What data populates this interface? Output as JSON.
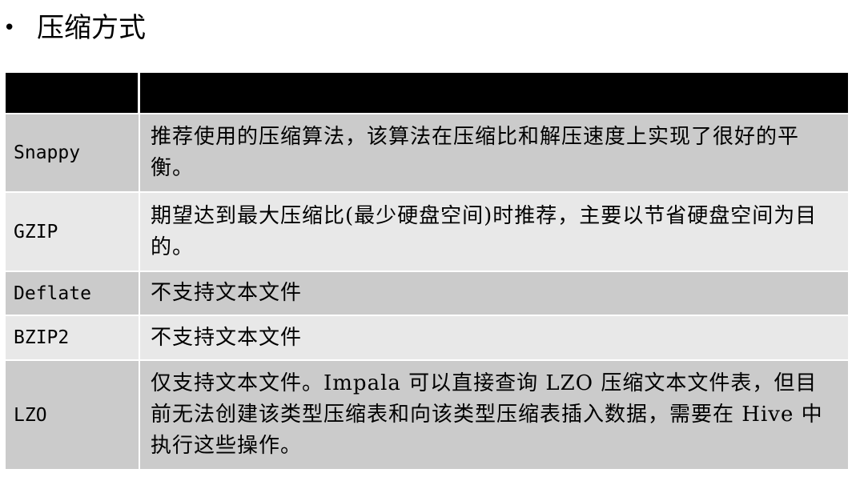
{
  "heading": {
    "bullet": "•",
    "title": "压缩方式"
  },
  "table": {
    "header": {
      "name": "",
      "description": ""
    },
    "rows": [
      {
        "name": "Snappy",
        "description": "推荐使用的压缩算法，该算法在压缩比和解压速度上实现了很好的平衡。",
        "shade": "dark"
      },
      {
        "name": "GZIP",
        "description": "期望达到最大压缩比(最少硬盘空间)时推荐，主要以节省硬盘空间为目的。",
        "shade": "light"
      },
      {
        "name": "Deflate",
        "description": "不支持文本文件",
        "shade": "dark"
      },
      {
        "name": "BZIP2",
        "description": "不支持文本文件",
        "shade": "light"
      },
      {
        "name": "LZO",
        "description": "仅支持文本文件。Impala 可以直接查询 LZO 压缩文本文件表，但目前无法创建该类型压缩表和向该类型压缩表插入数据，需要在 Hive 中执行这些操作。",
        "shade": "dark"
      }
    ]
  }
}
